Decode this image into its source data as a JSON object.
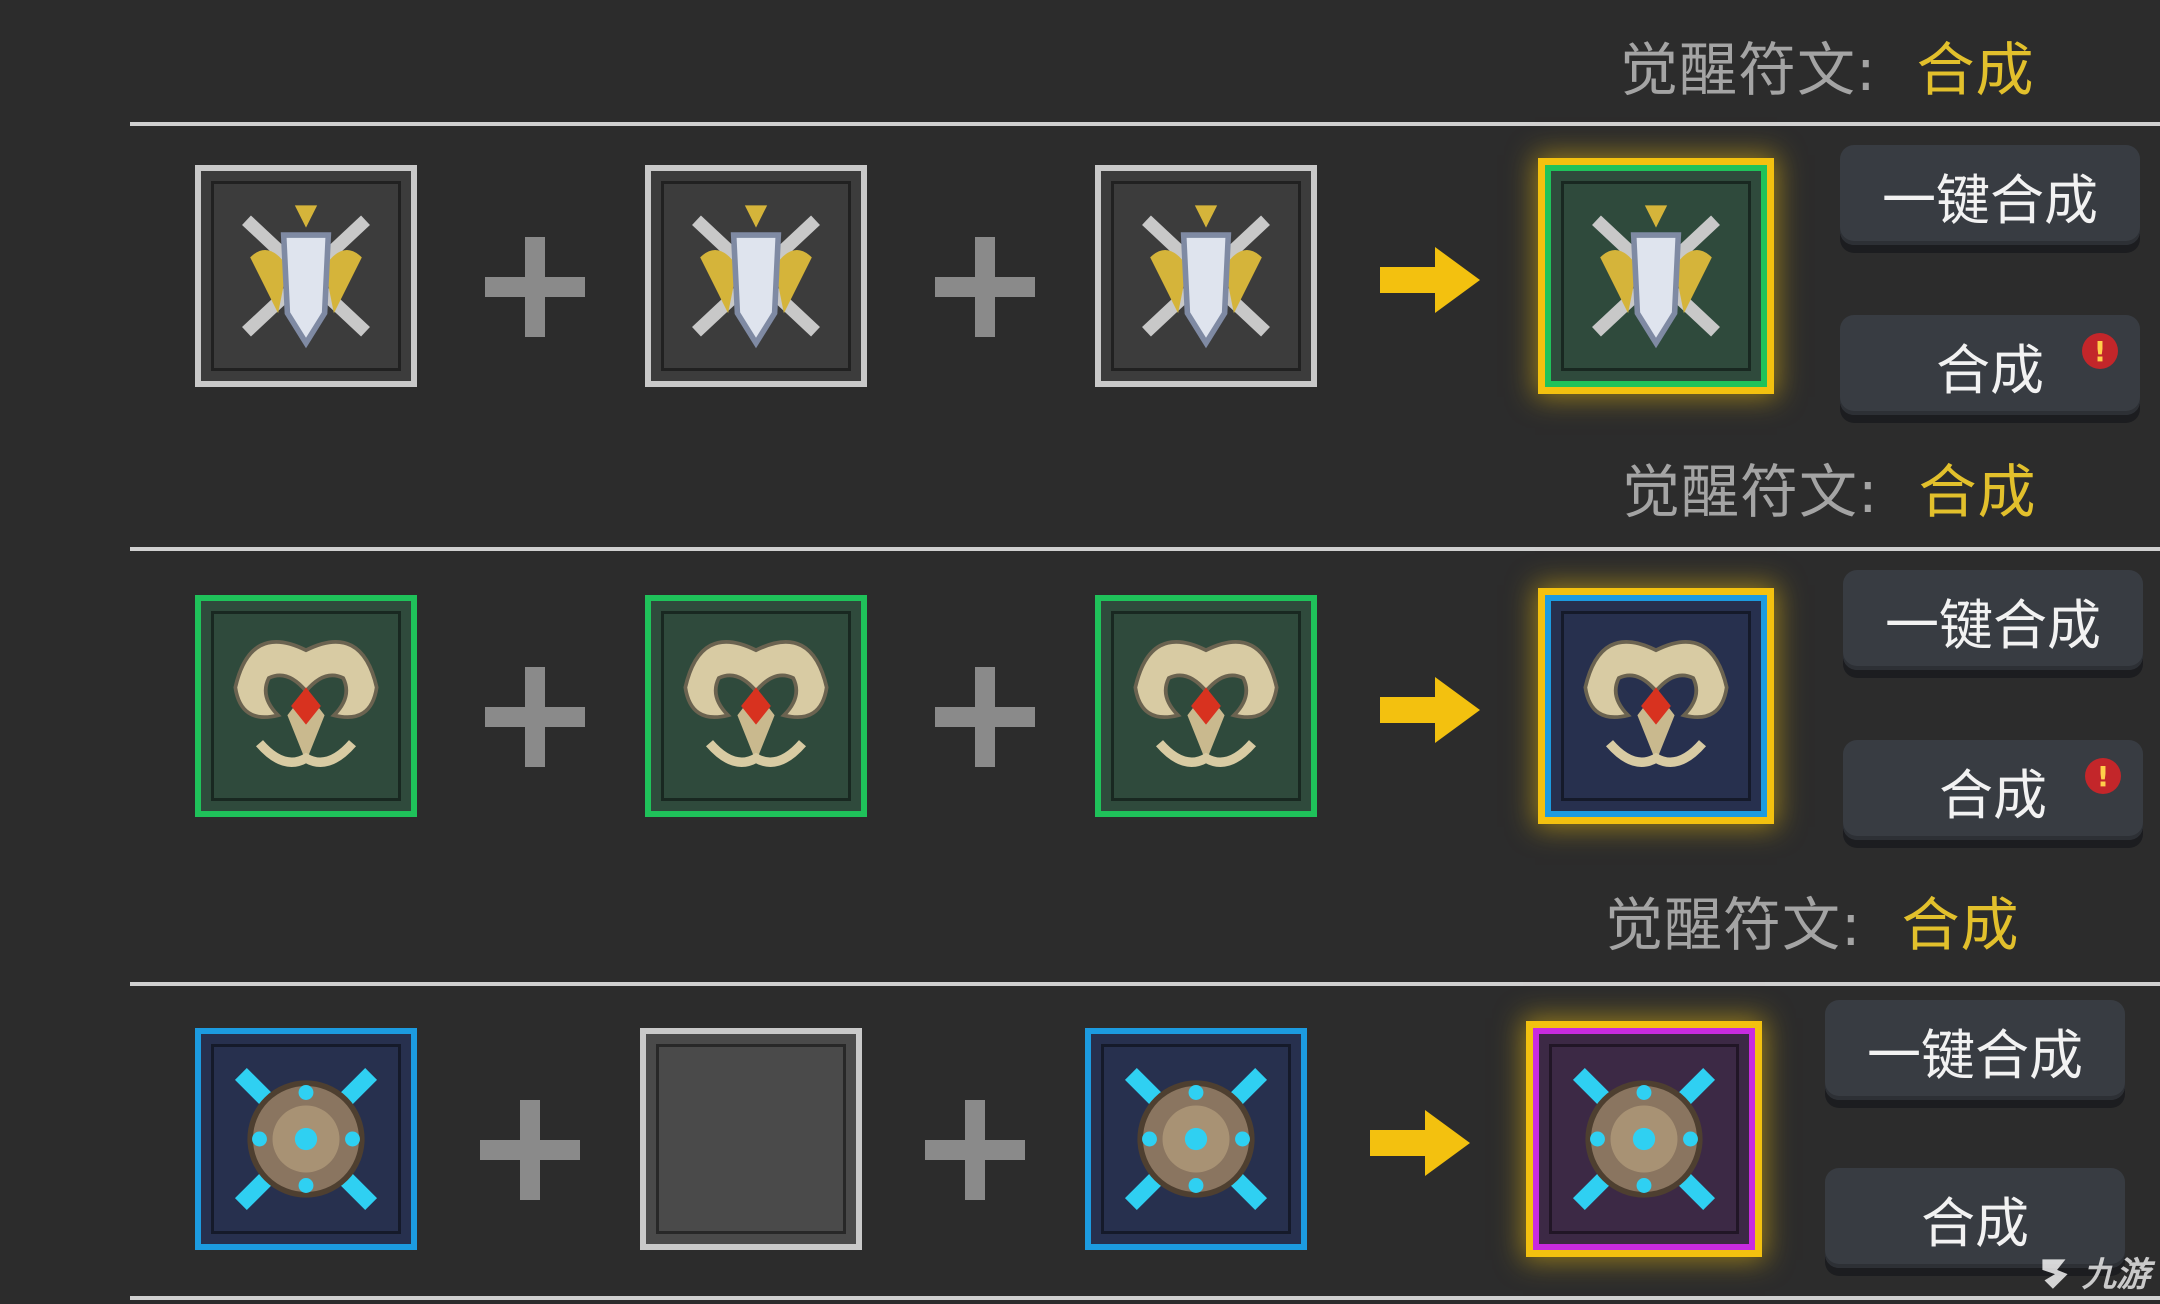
{
  "sections": [
    {
      "label": "觉醒符文:",
      "status": "合成",
      "inputs": [
        {
          "icon": "crossed-swords-shield-icon",
          "rarity": "gray"
        },
        {
          "icon": "crossed-swords-shield-icon",
          "rarity": "gray"
        },
        {
          "icon": "crossed-swords-shield-icon",
          "rarity": "gray"
        }
      ],
      "result": {
        "icon": "crossed-swords-shield-icon",
        "rarity": "green"
      },
      "one_click_label": "一键合成",
      "synth_label": "合成",
      "synth_alert": "!"
    },
    {
      "label": "觉醒符文:",
      "status": "合成",
      "inputs": [
        {
          "icon": "antler-amulet-icon",
          "rarity": "green"
        },
        {
          "icon": "antler-amulet-icon",
          "rarity": "green"
        },
        {
          "icon": "antler-amulet-icon",
          "rarity": "green"
        }
      ],
      "result": {
        "icon": "antler-amulet-icon",
        "rarity": "blue"
      },
      "one_click_label": "一键合成",
      "synth_label": "合成",
      "synth_alert": "!"
    },
    {
      "label": "觉醒符文:",
      "status": "合成",
      "inputs": [
        {
          "icon": "spiked-orb-icon",
          "rarity": "blue"
        },
        {
          "icon": "empty-slot",
          "rarity": "empty"
        },
        {
          "icon": "spiked-orb-icon",
          "rarity": "blue"
        }
      ],
      "result": {
        "icon": "spiked-orb-icon",
        "rarity": "purple"
      },
      "one_click_label": "一键合成",
      "synth_label": "合成"
    }
  ],
  "colors": {
    "background": "#2c2c2c",
    "status_yellow": "#e2c02c",
    "label_gray": "#a4a4a4",
    "result_glow": "#f3c10f",
    "rarity_gray": "#c9c9c9",
    "rarity_green": "#1fc25a",
    "rarity_blue": "#1c9be0",
    "rarity_purple": "#c82be0",
    "alert_red": "#c3262a"
  },
  "watermark": {
    "text": "九游",
    "icon": "jiuyou-logo-icon"
  }
}
